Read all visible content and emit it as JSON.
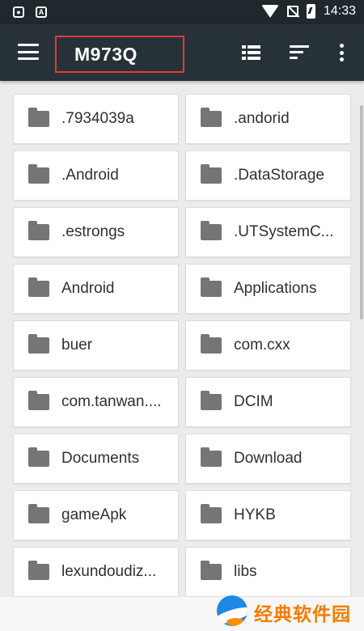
{
  "status_bar": {
    "time": "14:33",
    "left_icons": [
      "shield-icon",
      "app-a-icon"
    ],
    "right_icons": [
      "wifi-icon",
      "no-signal-icon",
      "battery-charging-icon"
    ]
  },
  "toolbar": {
    "title": "M973Q",
    "icons": [
      "hamburger-menu-icon",
      "list-view-icon",
      "sort-icon",
      "more-vert-icon"
    ],
    "background_color": "#263238",
    "highlight_color": "#e53935"
  },
  "folders": [
    {
      "name": ".7934039a"
    },
    {
      "name": ".andorid"
    },
    {
      "name": ".Android"
    },
    {
      "name": ".DataStorage"
    },
    {
      "name": ".estrongs"
    },
    {
      "name": ".UTSystemC..."
    },
    {
      "name": "Android"
    },
    {
      "name": "Applications"
    },
    {
      "name": "buer"
    },
    {
      "name": "com.cxx"
    },
    {
      "name": "com.tanwan...."
    },
    {
      "name": "DCIM"
    },
    {
      "name": "Documents"
    },
    {
      "name": "Download"
    },
    {
      "name": "gameApk"
    },
    {
      "name": "HYKB"
    },
    {
      "name": "lexundoudiz..."
    },
    {
      "name": "libs"
    }
  ],
  "watermark": {
    "text": "经典软件园"
  }
}
